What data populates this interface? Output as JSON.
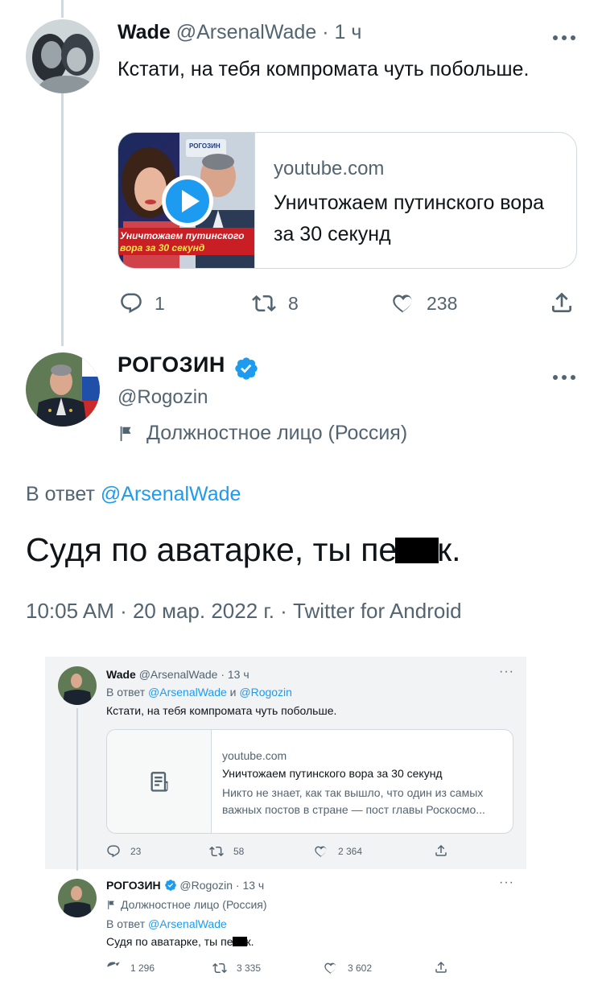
{
  "tweet1": {
    "name": "Wade",
    "handle": "@ArsenalWade",
    "time": "1 ч",
    "text": "Кстати, на тебя компромата чуть побольше.",
    "card": {
      "domain": "youtube.com",
      "title": "Уничтожаем путинского вора за 30 секунд",
      "thumb_caption_1": "Уничтожаем путинского",
      "thumb_caption_2": "вора за 30 секунд",
      "thumb_badge": "РОГОЗИН"
    },
    "actions": {
      "replies": "1",
      "retweets": "8",
      "likes": "238"
    }
  },
  "tweet2": {
    "name": "РОГОЗИН",
    "handle": "@Rogozin",
    "label": "Должностное лицо (Россия)",
    "reply_prefix": "В ответ",
    "reply_to": "@ArsenalWade",
    "text_before": "Судя по аватарке, ты пе",
    "text_after": "к.",
    "meta": "10:05 AM · 20 мар. 2022 г. · Twitter for Android"
  },
  "embedded": {
    "tweet1": {
      "name": "Wade",
      "handle_time": "@ArsenalWade · 13 ч",
      "reply_prefix": "В ответ",
      "reply_to_1": "@ArsenalWade",
      "reply_and": "и",
      "reply_to_2": "@Rogozin",
      "text": "Кстати, на тебя компромата чуть побольше.",
      "card": {
        "domain": "youtube.com",
        "title": "Уничтожаем путинского вора за 30 секунд",
        "desc": "Никто не знает, как так вышло, что один из самых важных постов в стране — пост главы Роскосмо..."
      },
      "actions": {
        "replies": "23",
        "retweets": "58",
        "likes": "2 364"
      }
    },
    "tweet2": {
      "name": "РОГОЗИН",
      "handle_time": "@Rogozin · 13 ч",
      "label": "Должностное лицо (Россия)",
      "reply_prefix": "В ответ",
      "reply_to": "@ArsenalWade",
      "text_before": "Судя по аватарке, ты пе",
      "text_after": "к.",
      "actions": {
        "replies": "1 296",
        "retweets": "3 335",
        "likes": "3 602"
      }
    }
  },
  "colors": {
    "accent": "#1d9bf0",
    "text": "#0f1419",
    "secondary": "#536471",
    "border": "#cfd9de",
    "verified": "#1d9bf0"
  },
  "icons": [
    "more-icon",
    "reply-icon",
    "retweet-icon",
    "like-icon",
    "share-icon",
    "verified-icon",
    "flag-icon",
    "play-icon",
    "article-icon"
  ]
}
